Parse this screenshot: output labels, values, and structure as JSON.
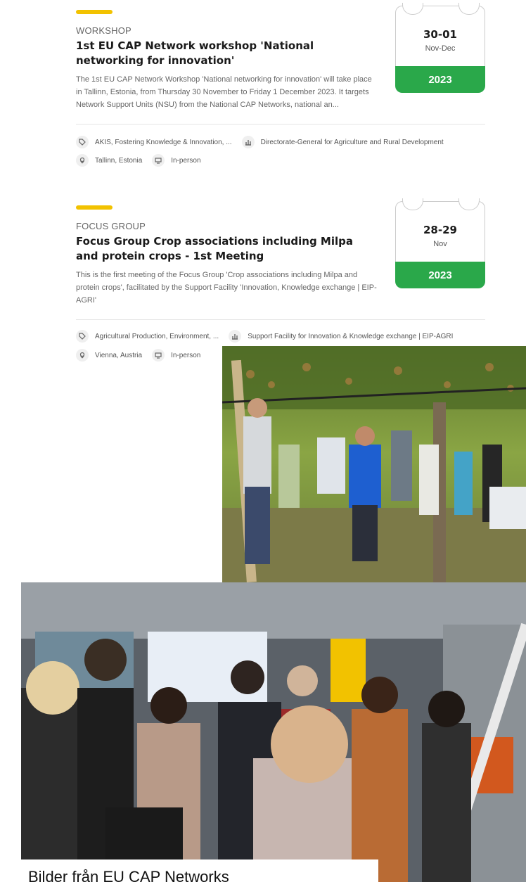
{
  "events": [
    {
      "category": "WORKSHOP",
      "title": "1st EU CAP Network workshop 'National networking for innovation'",
      "description": "The 1st EU CAP Network Workshop 'National networking for innovation' will take place in Tallinn, Estonia, from Thursday 30 November to Friday 1 December 2023. It targets Network Support Units (NSU) from the National CAP Networks, national an...",
      "date": {
        "days": "30-01",
        "months": "Nov-Dec",
        "year": "2023"
      },
      "tags": "AKIS, Fostering Knowledge & Innovation, ...",
      "organiser": "Directorate-General for Agriculture and Rural Development",
      "location": "Tallinn, Estonia",
      "format": "In-person"
    },
    {
      "category": "FOCUS GROUP",
      "title": "Focus Group Crop associations including Milpa and protein crops - 1st Meeting",
      "description": "This is the first meeting of the Focus Group 'Crop associations including Milpa and protein crops', facilitated by the Support Facility 'Innovation, Knowledge exchange | EIP-AGRI'",
      "date": {
        "days": "28-29",
        "months": "Nov",
        "year": "2023"
      },
      "tags": "Agricultural Production, Environment, ...",
      "organiser": "Support Facility for Innovation & Knowledge exchange | EIP-AGRI",
      "location": "Vienna, Austria",
      "format": "In-person"
    }
  ],
  "caption": "Bilder från EU CAP Networks",
  "colors": {
    "accent": "#f2c200",
    "year_green": "#2aa84a"
  },
  "icons": [
    "tag-icon",
    "organiser-icon",
    "location-pin-icon",
    "screen-icon"
  ]
}
